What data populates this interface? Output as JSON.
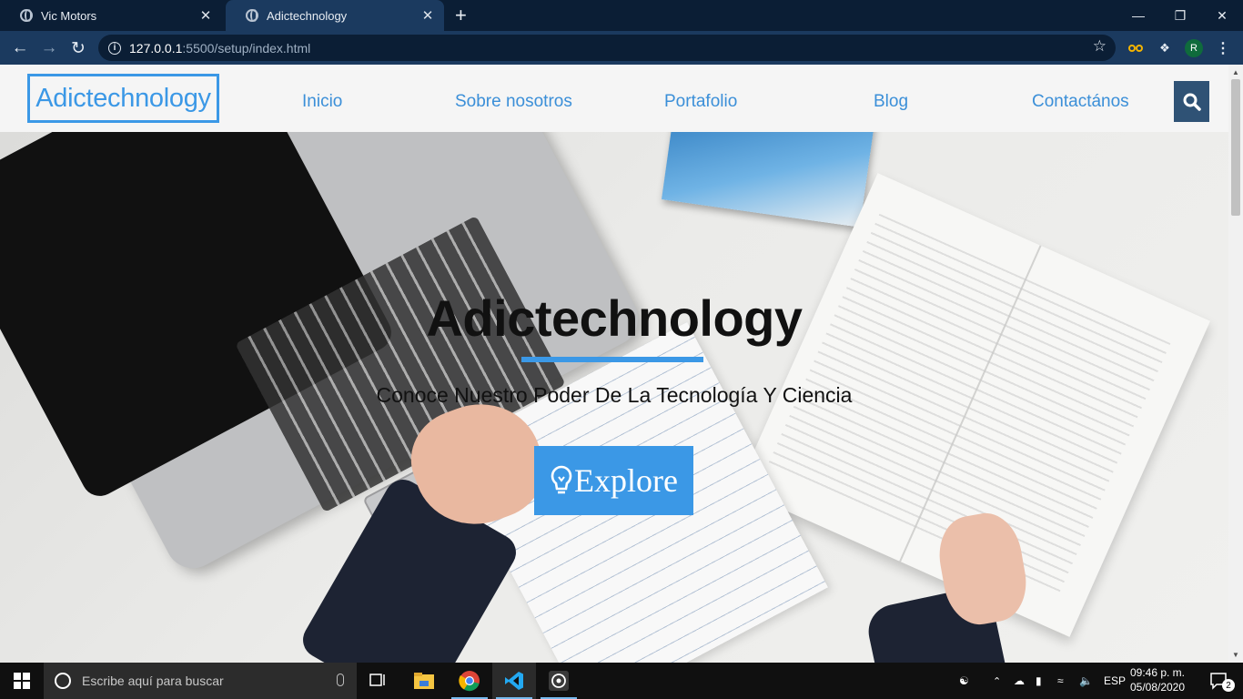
{
  "browser": {
    "tabs": [
      {
        "title": "Vic Motors",
        "active": false
      },
      {
        "title": "Adictechnology",
        "active": true
      }
    ],
    "new_tab_icon": "+",
    "url_host": "127.0.0.1",
    "url_rest": ":5500/setup/index.html",
    "profile_initial": "R"
  },
  "site": {
    "logo": "Adictechnology",
    "nav": [
      "Inicio",
      "Sobre nosotros",
      "Portafolio",
      "Blog",
      "Contactános"
    ],
    "search_icon": "search-icon"
  },
  "hero": {
    "title": "Adictechnology",
    "subtitle": "Conoce Nuestro Poder De La Tecnología Y Ciencia",
    "button_label": "Explore",
    "button_icon": "lightbulb-icon"
  },
  "taskbar": {
    "search_placeholder": "Escribe aquí para buscar",
    "language": "ESP",
    "time": "09:46 p. m.",
    "date": "05/08/2020",
    "notification_count": "2"
  },
  "colors": {
    "accent": "#3b98e6",
    "search_button": "#2f5275",
    "tab_bar": "#0b1e35",
    "toolbar": "#1b3a5f"
  }
}
